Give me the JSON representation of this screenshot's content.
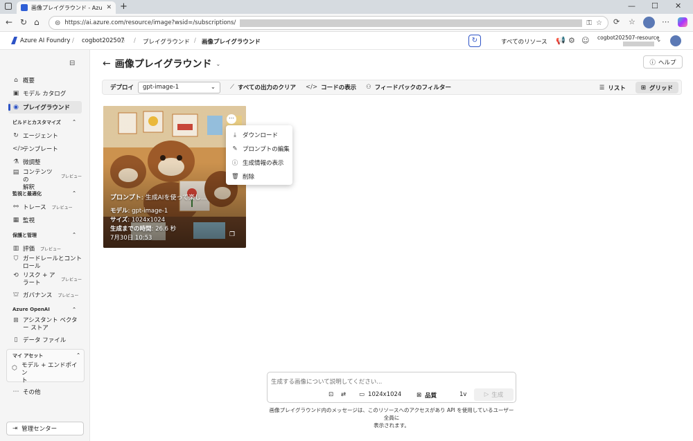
{
  "browser": {
    "tab_title": "画像プレイグラウンド - Azure AI Foun",
    "url_prefix": "https://ai.azure.com/resource/image?wsid=/subscriptions/"
  },
  "header": {
    "brand": "Azure AI Foundry",
    "breadcrumbs": [
      "cogbot202507",
      "プレイグラウンド",
      "画像プレイグラウンド"
    ],
    "all_resources": "すべてのリソース",
    "resource_name": "cogbot202507-resource"
  },
  "sidebar": {
    "items_top": [
      {
        "label": "概要",
        "icon": "home-icon"
      },
      {
        "label": "モデル カタログ",
        "icon": "catalog-icon"
      },
      {
        "label": "プレイグラウンド",
        "icon": "playground-icon"
      }
    ],
    "group_build": "ビルドとカスタマイズ",
    "items_build": [
      {
        "label": "エージェント",
        "icon": "agent-icon"
      },
      {
        "label": "テンプレート",
        "icon": "template-icon"
      },
      {
        "label": "微調整",
        "icon": "fine-tune-icon"
      },
      {
        "label": "コンテンツの解釈",
        "label2": "プレビュー",
        "icon": "content-icon"
      }
    ],
    "content_lines": [
      "コンテンツの",
      "解釈"
    ],
    "group_monitor": "監視と最適化",
    "items_monitor": [
      {
        "label": "トレース",
        "badge": "プレビュー"
      },
      {
        "label": "監視"
      }
    ],
    "group_protect": "保護と管理",
    "items_protect": [
      {
        "label": "評価",
        "badge": "プレビュー"
      },
      {
        "label": "ガードレールとコントロール"
      },
      {
        "label": "リスク + アラート",
        "badge": "プレビュー"
      },
      {
        "label": "ガバナンス",
        "badge": "プレビュー"
      }
    ],
    "guardrail_lines": [
      "ガードレールとコント",
      "ロール"
    ],
    "risk_lines": [
      "リスク + ア",
      "ラート"
    ],
    "group_openai": "Azure OpenAI",
    "items_openai": [
      {
        "label": "アシスタント ベクター ストア"
      },
      {
        "label": "データ ファイル"
      }
    ],
    "assistant_lines": [
      "アシスタント ベクタ",
      "ー ストア"
    ],
    "group_assets": "マイ アセット",
    "assets_lines": [
      "モデル + エンドポイン",
      "ト"
    ],
    "more": "その他",
    "management": "管理センター",
    "badge_preview": "プレビュー"
  },
  "main": {
    "title": "画像プレイグラウンド",
    "help": "ヘルプ",
    "toolbar": {
      "deploy_label": "デプロイ",
      "deploy_value": "gpt-image-1",
      "clear": "すべての出力のクリア",
      "code": "コードの表示",
      "feedback": "フィードバックのフィルター",
      "list": "リスト",
      "grid": "グリッド"
    },
    "card": {
      "prompt_label": "プロンプト",
      "prompt_value": ": 生成AIを使って楽し...",
      "model_label": "モデル",
      "model_value": ": gpt-image-1",
      "size_label": "サイズ",
      "size_value": ": 1024x1024",
      "time_label": "生成までの時間",
      "time_value": ": 26.6 秒",
      "date": "7月30日 10:53"
    },
    "menu": [
      {
        "label": "ダウンロード",
        "icon": "download-icon"
      },
      {
        "label": "プロンプトの編集",
        "icon": "edit-icon"
      },
      {
        "label": "生成情報の表示",
        "icon": "info-icon"
      },
      {
        "label": "削除",
        "icon": "delete-icon"
      }
    ],
    "composer": {
      "placeholder": "生成する画像について説明してください...",
      "size": "1024x1024",
      "quality": "品質",
      "count": "1v",
      "generate": "生成"
    },
    "disclaimer_lines": [
      "画像プレイグラウンド内のメッセージは、このリソースへのアクセスがあり API を使用しているユーザー全員に",
      "表示されます。"
    ]
  }
}
